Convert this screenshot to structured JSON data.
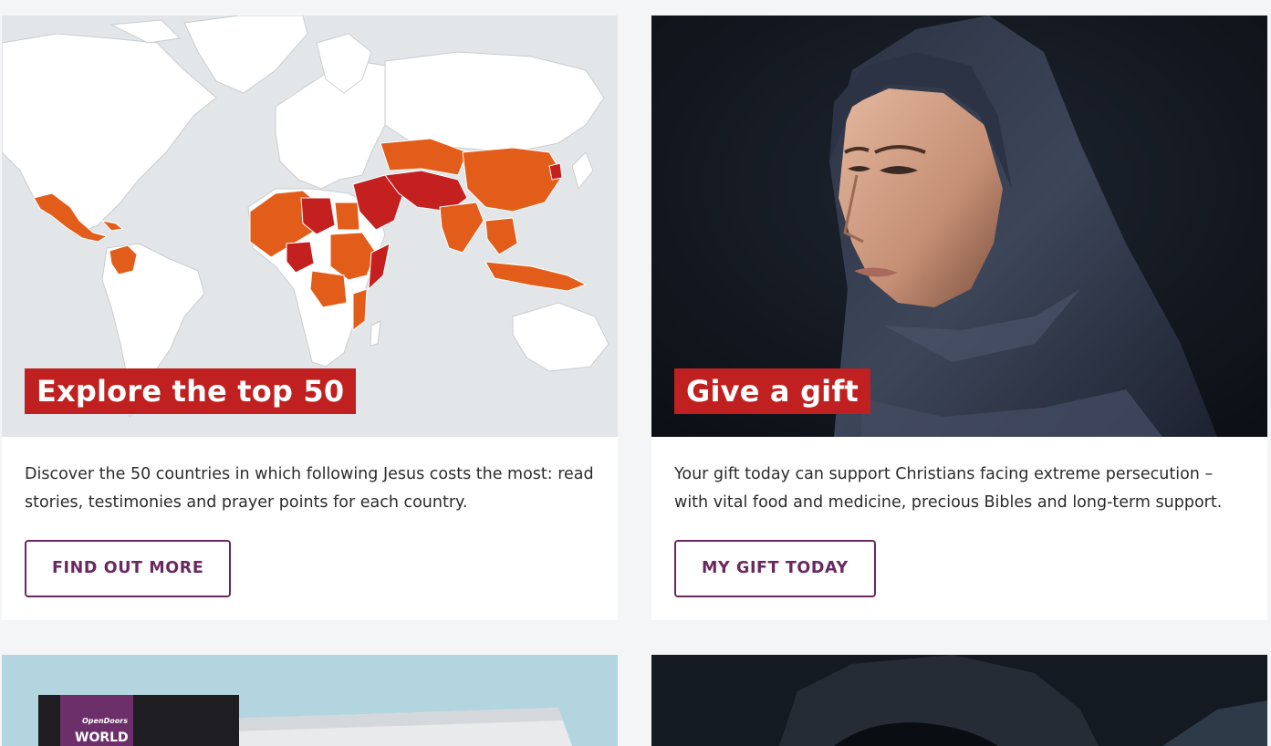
{
  "cards": [
    {
      "title": "Explore the top 50",
      "body": "Discover the 50 countries in which following Jesus costs the most: read stories, testimonies and prayer points for each country.",
      "button_label": "FIND OUT MORE",
      "image": "world-watch-list-map"
    },
    {
      "title": "Give a gift",
      "body": "Your gift today can support Christians facing extreme persecution – with vital food and medicine, precious Bibles and long-term support.",
      "button_label": "MY GIFT TODAY",
      "image": "woman-in-headscarf-portrait"
    }
  ],
  "bottom_cards": [
    {
      "image": "world-watch-list-booklet",
      "booklet_brand": "OpenDoors",
      "booklet_title": "WORLD"
    },
    {
      "image": "dark-portrait-photo"
    }
  ],
  "colors": {
    "title_badge": "#c0201f",
    "button_border": "#6a2860",
    "map_orange": "#e35d1a",
    "map_red": "#c4201f",
    "map_ocean": "#e3e6e9",
    "page_bg": "#f4f5f7"
  }
}
